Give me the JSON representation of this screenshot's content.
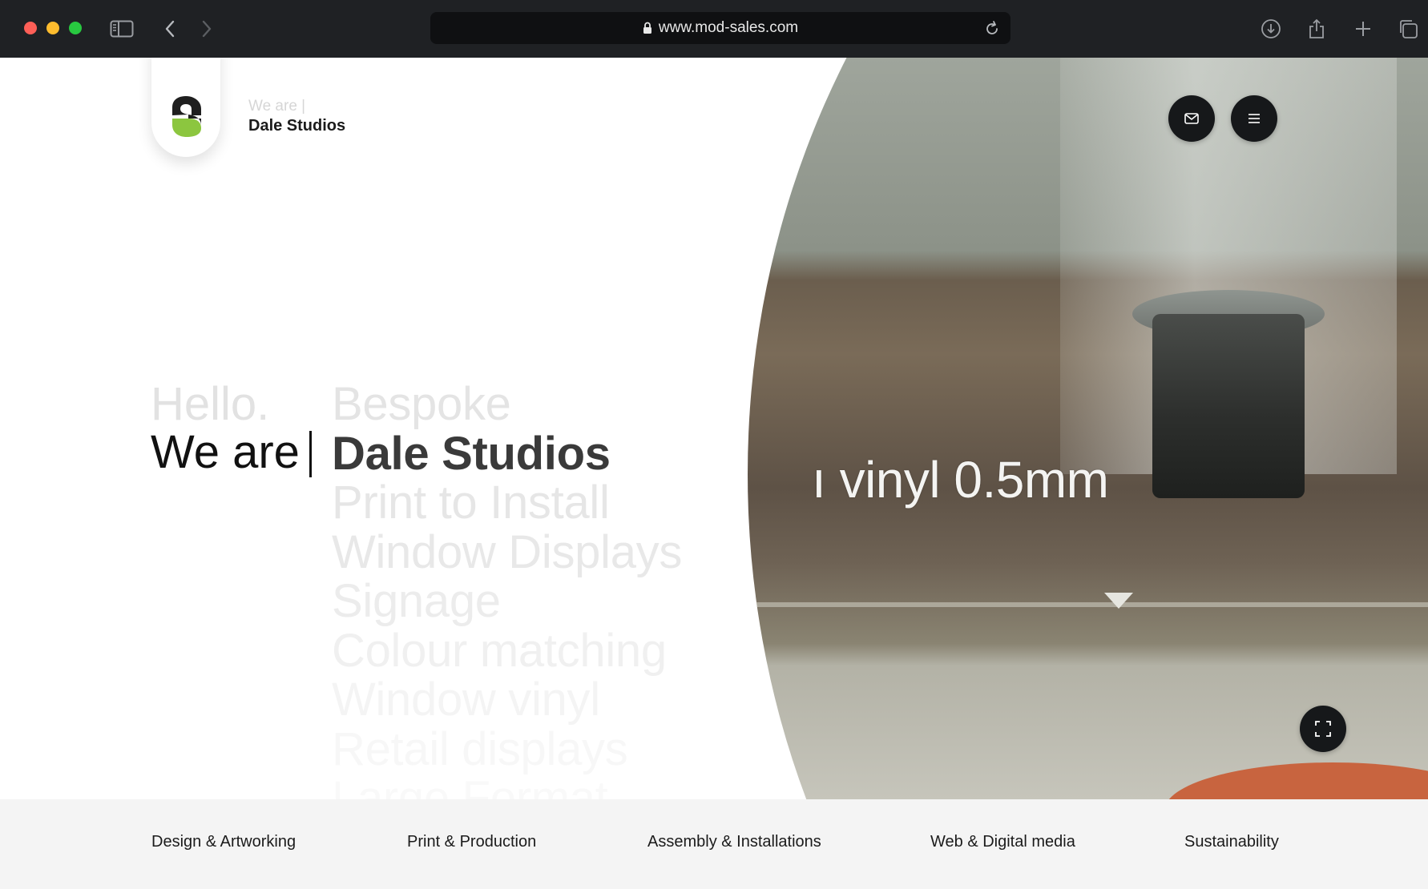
{
  "browser": {
    "url": "www.mod-sales.com"
  },
  "header": {
    "brand_prefix": "We are |",
    "brand_name": "Dale Studios",
    "logo_colors": {
      "dark": "#1f1f1f",
      "green": "#8cc63f"
    }
  },
  "hero": {
    "greeting": "Hello.",
    "we_are": "We are",
    "words": [
      {
        "text": "Bespoke",
        "color": "#e4e4e4",
        "bold": false
      },
      {
        "text": "Dale Studios",
        "color": "#3a3a3a",
        "bold": true
      },
      {
        "text": "Print to Install",
        "color": "#e6e6e6",
        "bold": false
      },
      {
        "text": "Window Displays",
        "color": "#e8e8e8",
        "bold": false
      },
      {
        "text": "Signage",
        "color": "#ececec",
        "bold": false
      },
      {
        "text": "Colour matching",
        "color": "#f0f0f0",
        "bold": false
      },
      {
        "text": "Window vinyl",
        "color": "#f4f4f4",
        "bold": false
      },
      {
        "text": "Retail displays",
        "color": "#f7f7f7",
        "bold": false
      },
      {
        "text": "Large Format",
        "color": "#f9f9f9",
        "bold": false
      }
    ],
    "media_caption": "ı vinyl 0.5mm"
  },
  "actions": {
    "mail_icon": "mail-icon",
    "menu_icon": "hamburger-menu-icon",
    "fullscreen_icon": "fullscreen-icon"
  },
  "bottom_nav": {
    "items": [
      "Design & Artworking",
      "Print & Production",
      "Assembly & Installations",
      "Web & Digital media",
      "Sustainability"
    ]
  }
}
